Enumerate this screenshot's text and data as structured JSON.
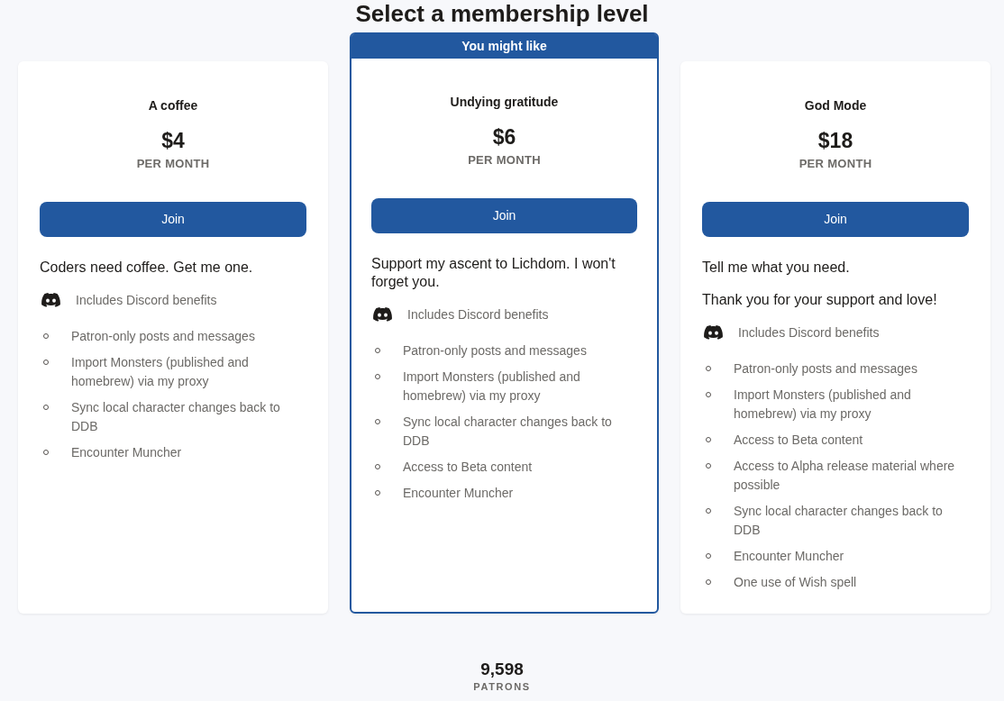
{
  "page": {
    "title": "Select a membership level"
  },
  "tiers": [
    {
      "name": "A coffee",
      "price": "$4",
      "period": "PER MONTH",
      "button": "Join",
      "description": [
        "Coders need coffee. Get me one."
      ],
      "discord": "Includes Discord benefits",
      "benefits": [
        "Patron-only posts and messages",
        "Import Monsters (published and homebrew) via my proxy",
        "Sync local character changes back to DDB",
        "Encounter Muncher"
      ]
    },
    {
      "banner": "You might like",
      "name": "Undying gratitude",
      "price": "$6",
      "period": "PER MONTH",
      "button": "Join",
      "description": [
        "Support my ascent to Lichdom. I won't forget you."
      ],
      "discord": "Includes Discord benefits",
      "benefits": [
        "Patron-only posts and messages",
        "Import Monsters (published and homebrew) via my proxy",
        "Sync local character changes back to DDB",
        "Access to Beta content",
        "Encounter Muncher"
      ]
    },
    {
      "name": "God Mode",
      "price": "$18",
      "period": "PER MONTH",
      "button": "Join",
      "description": [
        "Tell me what you need.",
        "Thank you for your support and love!"
      ],
      "discord": "Includes Discord benefits",
      "benefits": [
        "Patron-only posts and messages",
        "Import Monsters (published and homebrew) via my proxy",
        "Access to Beta content",
        "Access to Alpha release material where possible",
        "Sync local character changes back to DDB",
        "Encounter Muncher",
        "One use of Wish spell"
      ]
    }
  ],
  "patrons": {
    "count": "9,598",
    "label": "PATRONS"
  }
}
